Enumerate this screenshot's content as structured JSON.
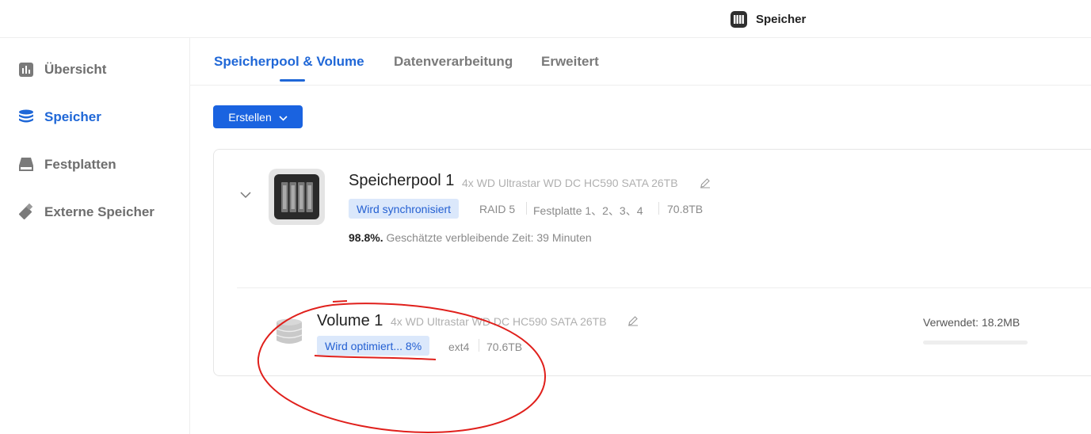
{
  "app": {
    "title": "Speicher",
    "icon": "storage-manager-icon"
  },
  "sidebar": {
    "items": [
      {
        "label": "Übersicht",
        "icon": "overview-chart-icon",
        "active": false
      },
      {
        "label": "Speicher",
        "icon": "database-icon",
        "active": true
      },
      {
        "label": "Festplatten",
        "icon": "hard-disk-icon",
        "active": false
      },
      {
        "label": "Externe Speicher",
        "icon": "usb-drive-icon",
        "active": false
      }
    ]
  },
  "tabs": [
    {
      "label": "Speicherpool & Volume",
      "active": true
    },
    {
      "label": "Datenverarbeitung",
      "active": false
    },
    {
      "label": "Erweitert",
      "active": false
    }
  ],
  "toolbar": {
    "create_label": "Erstellen"
  },
  "pool": {
    "name": "Speicherpool 1",
    "disks": "4x WD Ultrastar WD DC HC590 SATA 26TB",
    "status": "Wird synchronisiert",
    "raid": "RAID 5",
    "drives": "Festplatte 1、2、3、4",
    "capacity": "70.8TB",
    "progress_percent": "98.8%.",
    "remaining": "Geschätzte verbleibende Zeit: 39 Minuten"
  },
  "volume": {
    "name": "Volume 1",
    "disks": "4x WD Ultrastar WD DC HC590 SATA 26TB",
    "status": "Wird optimiert... 8%",
    "filesystem": "ext4",
    "capacity": "70.6TB",
    "used": "Verwendet: 18.2MB",
    "used_fraction": 0.0
  },
  "colors": {
    "accent": "#1a63e0",
    "badge_bg": "#dbe8fb",
    "annotation": "#e0201c"
  }
}
